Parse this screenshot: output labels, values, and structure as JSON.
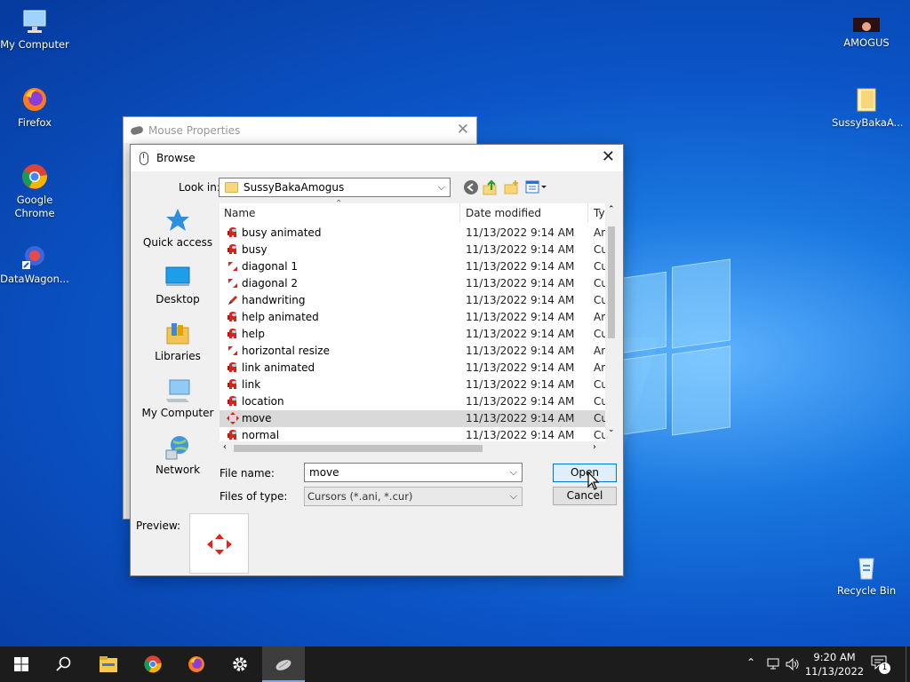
{
  "desktop": {
    "icons": [
      {
        "label": "My Computer"
      },
      {
        "label": "Firefox"
      },
      {
        "label": "Google Chrome"
      },
      {
        "label": "DataWagon..."
      },
      {
        "label": "AMOGUS"
      },
      {
        "label": "SussyBakaA..."
      },
      {
        "label": "Recycle Bin"
      }
    ]
  },
  "mouse_properties": {
    "title": "Mouse Properties"
  },
  "browse_dialog": {
    "title": "Browse",
    "look_in_label": "Look in:",
    "look_in_value": "SussyBakaAmogus",
    "places": [
      {
        "label": "Quick access"
      },
      {
        "label": "Desktop"
      },
      {
        "label": "Libraries"
      },
      {
        "label": "My Computer"
      },
      {
        "label": "Network"
      }
    ],
    "columns": {
      "name": "Name",
      "date": "Date modified",
      "type": "Ty"
    },
    "files": [
      {
        "name": "busy animated",
        "date": "11/13/2022 9:14 AM",
        "type": "Ar",
        "icon": "amogus"
      },
      {
        "name": "busy",
        "date": "11/13/2022 9:14 AM",
        "type": "Cu",
        "icon": "amogus"
      },
      {
        "name": "diagonal 1",
        "date": "11/13/2022 9:14 AM",
        "type": "Cu",
        "icon": "arrow"
      },
      {
        "name": "diagonal 2",
        "date": "11/13/2022 9:14 AM",
        "type": "Cu",
        "icon": "arrow"
      },
      {
        "name": "handwriting",
        "date": "11/13/2022 9:14 AM",
        "type": "Cu",
        "icon": "pen"
      },
      {
        "name": "help animated",
        "date": "11/13/2022 9:14 AM",
        "type": "Ar",
        "icon": "amogus"
      },
      {
        "name": "help",
        "date": "11/13/2022 9:14 AM",
        "type": "Cu",
        "icon": "amogus"
      },
      {
        "name": "horizontal resize",
        "date": "11/13/2022 9:14 AM",
        "type": "Ar",
        "icon": "arrow"
      },
      {
        "name": "link animated",
        "date": "11/13/2022 9:14 AM",
        "type": "Ar",
        "icon": "amogus"
      },
      {
        "name": "link",
        "date": "11/13/2022 9:14 AM",
        "type": "Cu",
        "icon": "amogus"
      },
      {
        "name": "location",
        "date": "11/13/2022 9:14 AM",
        "type": "Cu",
        "icon": "amogus"
      },
      {
        "name": "move",
        "date": "11/13/2022 9:14 AM",
        "type": "Cu",
        "icon": "move",
        "selected": true
      },
      {
        "name": "normal",
        "date": "11/13/2022 9:14 AM",
        "type": "Cu",
        "icon": "amogus"
      }
    ],
    "file_name_label": "File name:",
    "file_name_value": "move",
    "files_of_type_label": "Files of type:",
    "files_of_type_value": "Cursors (*.ani, *.cur)",
    "open_label": "Open",
    "cancel_label": "Cancel",
    "preview_label": "Preview:"
  },
  "taskbar": {
    "time": "9:20 AM",
    "date": "11/13/2022",
    "notification_count": "1"
  },
  "colors": {
    "accent": "#0078d7",
    "selection": "#d9d9d9",
    "taskbar": "#1c1c1c"
  }
}
